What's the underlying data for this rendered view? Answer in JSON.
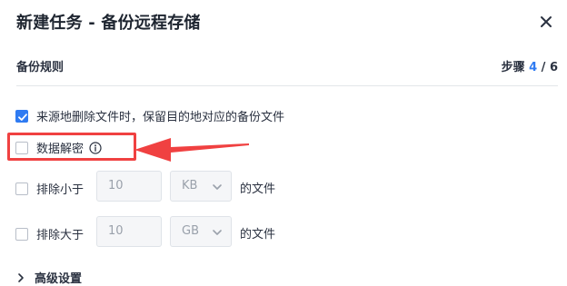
{
  "dialog": {
    "title": "新建任务 - 备份远程存储",
    "close_icon": "close-icon"
  },
  "header": {
    "section_label": "备份规则",
    "steps_prefix": "步骤 ",
    "step_current": "4",
    "steps_suffix": " / 6"
  },
  "options": {
    "keep_backup": {
      "label": "来源地删除文件时，保留目的地对应的备份文件",
      "checked": true
    },
    "decrypt": {
      "label": "数据解密",
      "checked": false,
      "info_icon": "info-icon"
    },
    "exclude_smaller": {
      "label": "排除小于",
      "checked": false,
      "value": "10",
      "unit": "KB",
      "suffix": "的文件"
    },
    "exclude_larger": {
      "label": "排除大于",
      "checked": false,
      "value": "10",
      "unit": "GB",
      "suffix": "的文件"
    }
  },
  "advanced": {
    "label": "高级设置",
    "icon": "chevron-right-icon"
  },
  "annotation": {
    "highlight_color": "#f04141"
  },
  "colors": {
    "accent": "#2f7bf2"
  }
}
